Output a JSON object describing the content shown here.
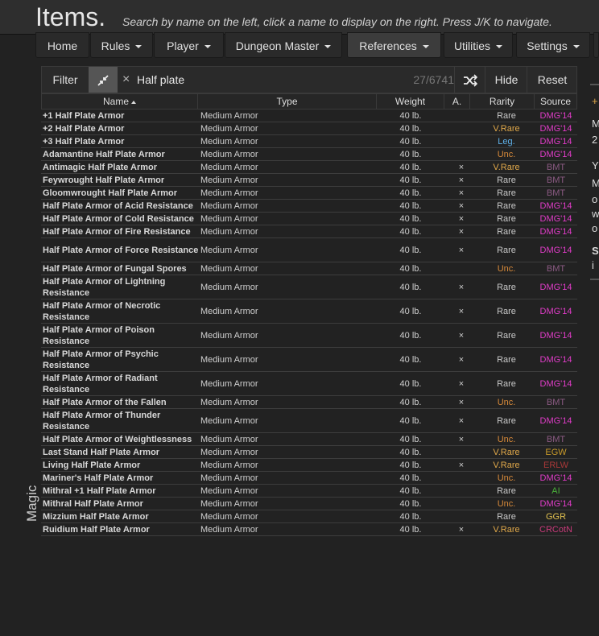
{
  "header": {
    "title": "Items.",
    "subtitle": "Search by name on the left, click a name to display on the right. Press J/K to navigate."
  },
  "nav": {
    "items": [
      {
        "label": "Home"
      },
      {
        "label": "Rules"
      },
      {
        "label": "Player"
      },
      {
        "label": "Dungeon Master"
      },
      {
        "label": "References"
      },
      {
        "label": "Utilities"
      },
      {
        "label": "Settings"
      }
    ]
  },
  "filter": {
    "label": "Filter",
    "clear_icon": "×",
    "search_value": "Half plate",
    "count": "27/6741",
    "shuffle_icon": "shuffle-icon",
    "hide_label": "Hide",
    "reset_label": "Reset"
  },
  "table": {
    "columns": [
      "Name",
      "Type",
      "Weight",
      "A.",
      "Rarity",
      "Source"
    ],
    "group_label": "Magic",
    "rows": [
      {
        "name": "+1 Half Plate Armor",
        "type": "Medium Armor",
        "weight": "40 lb.",
        "attune": "",
        "rarity": "Rare",
        "source": "DMG'14"
      },
      {
        "name": "+2 Half Plate Armor",
        "type": "Medium Armor",
        "weight": "40 lb.",
        "attune": "",
        "rarity": "V.Rare",
        "source": "DMG'14"
      },
      {
        "name": "+3 Half Plate Armor",
        "type": "Medium Armor",
        "weight": "40 lb.",
        "attune": "",
        "rarity": "Leg.",
        "source": "DMG'14"
      },
      {
        "name": "Adamantine Half Plate Armor",
        "type": "Medium Armor",
        "weight": "40 lb.",
        "attune": "",
        "rarity": "Unc.",
        "source": "DMG'14"
      },
      {
        "name": "Antimagic Half Plate Armor",
        "type": "Medium Armor",
        "weight": "40 lb.",
        "attune": "×",
        "rarity": "V.Rare",
        "source": "BMT"
      },
      {
        "name": "Feywrought Half Plate Armor",
        "type": "Medium Armor",
        "weight": "40 lb.",
        "attune": "×",
        "rarity": "Rare",
        "source": "BMT"
      },
      {
        "name": "Gloomwrought Half Plate Armor",
        "type": "Medium Armor",
        "weight": "40 lb.",
        "attune": "×",
        "rarity": "Rare",
        "source": "BMT"
      },
      {
        "name": "Half Plate Armor of Acid Resistance",
        "type": "Medium Armor",
        "weight": "40 lb.",
        "attune": "×",
        "rarity": "Rare",
        "source": "DMG'14"
      },
      {
        "name": "Half Plate Armor of Cold Resistance",
        "type": "Medium Armor",
        "weight": "40 lb.",
        "attune": "×",
        "rarity": "Rare",
        "source": "DMG'14"
      },
      {
        "name": "Half Plate Armor of Fire Resistance",
        "type": "Medium Armor",
        "weight": "40 lb.",
        "attune": "×",
        "rarity": "Rare",
        "source": "DMG'14"
      },
      {
        "name": "Half Plate Armor of Force Resistance",
        "type": "Medium Armor",
        "weight": "40 lb.",
        "attune": "×",
        "rarity": "Rare",
        "source": "DMG'14"
      },
      {
        "name": "Half Plate Armor of Fungal Spores",
        "type": "Medium Armor",
        "weight": "40 lb.",
        "attune": "",
        "rarity": "Unc.",
        "source": "BMT"
      },
      {
        "name": "Half Plate Armor of Lightning Resistance",
        "type": "Medium Armor",
        "weight": "40 lb.",
        "attune": "×",
        "rarity": "Rare",
        "source": "DMG'14"
      },
      {
        "name": "Half Plate Armor of Necrotic Resistance",
        "type": "Medium Armor",
        "weight": "40 lb.",
        "attune": "×",
        "rarity": "Rare",
        "source": "DMG'14"
      },
      {
        "name": "Half Plate Armor of Poison Resistance",
        "type": "Medium Armor",
        "weight": "40 lb.",
        "attune": "×",
        "rarity": "Rare",
        "source": "DMG'14"
      },
      {
        "name": "Half Plate Armor of Psychic Resistance",
        "type": "Medium Armor",
        "weight": "40 lb.",
        "attune": "×",
        "rarity": "Rare",
        "source": "DMG'14"
      },
      {
        "name": "Half Plate Armor of Radiant Resistance",
        "type": "Medium Armor",
        "weight": "40 lb.",
        "attune": "×",
        "rarity": "Rare",
        "source": "DMG'14"
      },
      {
        "name": "Half Plate Armor of the Fallen",
        "type": "Medium Armor",
        "weight": "40 lb.",
        "attune": "×",
        "rarity": "Unc.",
        "source": "BMT"
      },
      {
        "name": "Half Plate Armor of Thunder Resistance",
        "type": "Medium Armor",
        "weight": "40 lb.",
        "attune": "×",
        "rarity": "Rare",
        "source": "DMG'14"
      },
      {
        "name": "Half Plate Armor of Weightlessness",
        "type": "Medium Armor",
        "weight": "40 lb.",
        "attune": "×",
        "rarity": "Unc.",
        "source": "BMT"
      },
      {
        "name": "Last Stand Half Plate Armor",
        "type": "Medium Armor",
        "weight": "40 lb.",
        "attune": "",
        "rarity": "V.Rare",
        "source": "EGW"
      },
      {
        "name": "Living Half Plate Armor",
        "type": "Medium Armor",
        "weight": "40 lb.",
        "attune": "×",
        "rarity": "V.Rare",
        "source": "ERLW"
      },
      {
        "name": "Mariner's Half Plate Armor",
        "type": "Medium Armor",
        "weight": "40 lb.",
        "attune": "",
        "rarity": "Unc.",
        "source": "DMG'14"
      },
      {
        "name": "Mithral +1 Half Plate Armor",
        "type": "Medium Armor",
        "weight": "40 lb.",
        "attune": "",
        "rarity": "Rare",
        "source": "AI"
      },
      {
        "name": "Mithral Half Plate Armor",
        "type": "Medium Armor",
        "weight": "40 lb.",
        "attune": "",
        "rarity": "Unc.",
        "source": "DMG'14"
      },
      {
        "name": "Mizzium Half Plate Armor",
        "type": "Medium Armor",
        "weight": "40 lb.",
        "attune": "",
        "rarity": "Rare",
        "source": "GGR"
      },
      {
        "name": "Ruidium Half Plate Armor",
        "type": "Medium Armor",
        "weight": "40 lb.",
        "attune": "×",
        "rarity": "V.Rare",
        "source": "CRCotN"
      }
    ]
  },
  "colors": {
    "rarity": {
      "Rare": "#c9c9c9",
      "V.Rare": "#e0a84a",
      "Leg.": "#5fb0e8",
      "Unc.": "#d88a3a"
    },
    "source": {
      "DMG'14": "#e03cc8",
      "BMT": "#8a5a82",
      "EGW": "#c89a2a",
      "ERLW": "#a83838",
      "AI": "#4ab03a",
      "GGR": "#e0c050",
      "CRCotN": "#c83a7a"
    }
  },
  "right_panel": {
    "lines": [
      "+",
      "M",
      "2",
      "Y",
      "M",
      "o",
      "w",
      "o",
      "S",
      "i"
    ]
  }
}
